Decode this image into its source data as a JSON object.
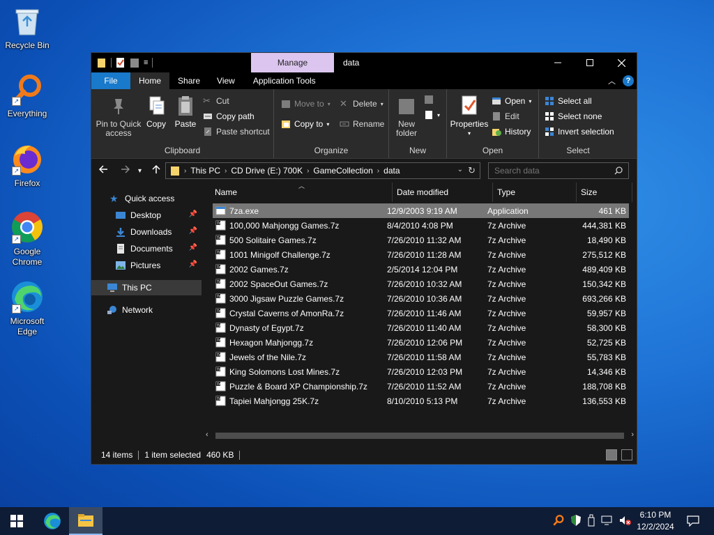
{
  "desktop": {
    "icons": [
      {
        "label": "Recycle Bin",
        "icon": "recycle-bin-icon"
      },
      {
        "label": "Everything",
        "icon": "everything-search-icon"
      },
      {
        "label": "Firefox",
        "icon": "firefox-icon"
      },
      {
        "label": "Google Chrome",
        "icon": "chrome-icon"
      },
      {
        "label": "Microsoft Edge",
        "icon": "edge-icon"
      }
    ]
  },
  "window": {
    "title": "data",
    "context_tab": "Manage",
    "tabs": [
      "File",
      "Home",
      "Share",
      "View",
      "Application Tools"
    ]
  },
  "ribbon": {
    "clipboard": {
      "label": "Clipboard",
      "pin": "Pin to Quick access",
      "copy": "Copy",
      "paste": "Paste",
      "cut": "Cut",
      "copy_path": "Copy path",
      "paste_shortcut": "Paste shortcut"
    },
    "organize": {
      "label": "Organize",
      "move_to": "Move to",
      "copy_to": "Copy to",
      "delete": "Delete",
      "rename": "Rename"
    },
    "new": {
      "label": "New",
      "new_folder": "New folder"
    },
    "open": {
      "label": "Open",
      "properties": "Properties",
      "open": "Open",
      "edit": "Edit",
      "history": "History"
    },
    "select": {
      "label": "Select",
      "select_all": "Select all",
      "select_none": "Select none",
      "invert": "Invert selection"
    }
  },
  "address": {
    "crumbs": [
      "This PC",
      "CD Drive (E:) 700K",
      "GameCollection",
      "data"
    ],
    "search_placeholder": "Search data"
  },
  "navpane": {
    "quick_access": "Quick access",
    "items": [
      "Desktop",
      "Downloads",
      "Documents",
      "Pictures"
    ],
    "this_pc": "This PC",
    "network": "Network"
  },
  "columns": {
    "name": "Name",
    "date": "Date modified",
    "type": "Type",
    "size": "Size"
  },
  "files": [
    {
      "name": "7za.exe",
      "date": "12/9/2003 9:19 AM",
      "type": "Application",
      "size": "461 KB",
      "selected": true
    },
    {
      "name": "100,000 Mahjongg Games.7z",
      "date": "8/4/2010 4:08 PM",
      "type": "7z Archive",
      "size": "444,381 KB"
    },
    {
      "name": "500 Solitaire Games.7z",
      "date": "7/26/2010 11:32 AM",
      "type": "7z Archive",
      "size": "18,490 KB"
    },
    {
      "name": "1001 Minigolf Challenge.7z",
      "date": "7/26/2010 11:28 AM",
      "type": "7z Archive",
      "size": "275,512 KB"
    },
    {
      "name": "2002 Games.7z",
      "date": "2/5/2014 12:04 PM",
      "type": "7z Archive",
      "size": "489,409 KB"
    },
    {
      "name": "2002 SpaceOut Games.7z",
      "date": "7/26/2010 10:32 AM",
      "type": "7z Archive",
      "size": "150,342 KB"
    },
    {
      "name": "3000 Jigsaw Puzzle Games.7z",
      "date": "7/26/2010 10:36 AM",
      "type": "7z Archive",
      "size": "693,266 KB"
    },
    {
      "name": "Crystal Caverns of AmonRa.7z",
      "date": "7/26/2010 11:46 AM",
      "type": "7z Archive",
      "size": "59,957 KB"
    },
    {
      "name": "Dynasty of Egypt.7z",
      "date": "7/26/2010 11:40 AM",
      "type": "7z Archive",
      "size": "58,300 KB"
    },
    {
      "name": "Hexagon Mahjongg.7z",
      "date": "7/26/2010 12:06 PM",
      "type": "7z Archive",
      "size": "52,725 KB"
    },
    {
      "name": "Jewels of the Nile.7z",
      "date": "7/26/2010 11:58 AM",
      "type": "7z Archive",
      "size": "55,783 KB"
    },
    {
      "name": "King Solomons Lost Mines.7z",
      "date": "7/26/2010 12:03 PM",
      "type": "7z Archive",
      "size": "14,346 KB"
    },
    {
      "name": "Puzzle & Board XP Championship.7z",
      "date": "7/26/2010 11:52 AM",
      "type": "7z Archive",
      "size": "188,708 KB"
    },
    {
      "name": "Tapiei Mahjongg 25K.7z",
      "date": "8/10/2010 5:13 PM",
      "type": "7z Archive",
      "size": "136,553 KB"
    }
  ],
  "status": {
    "count": "14 items",
    "selected": "1 item selected",
    "size": "460 KB"
  },
  "taskbar": {
    "time": "6:10 PM",
    "date": "12/2/2024"
  },
  "colors": {
    "accent": "#1979ca",
    "context_tab": "#dcc6f0",
    "selection": "#777777",
    "taskbar": "#0f1c35"
  }
}
